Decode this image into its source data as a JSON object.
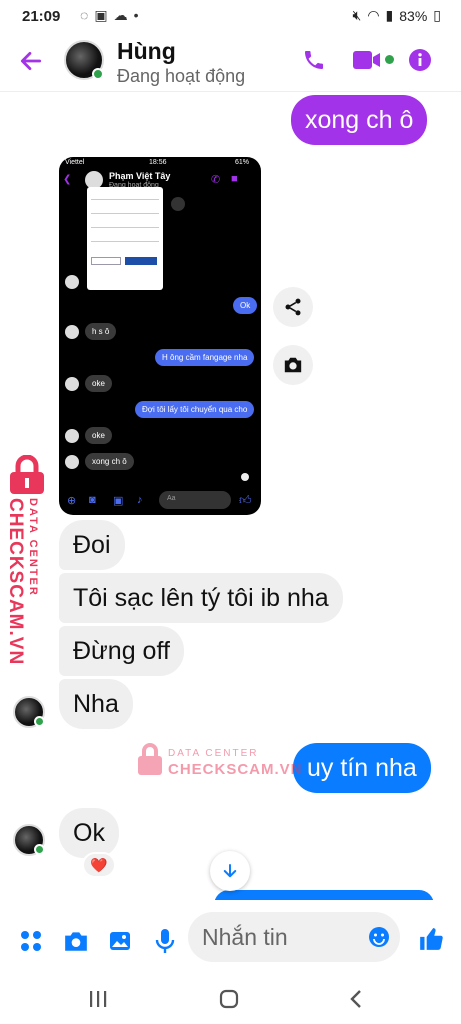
{
  "status_bar": {
    "time": "21:09",
    "battery": "83%"
  },
  "header": {
    "contact_name": "Hùng",
    "presence": "Đang hoạt động",
    "icons": [
      "back-arrow-icon",
      "phone-icon",
      "video-call-icon",
      "info-icon"
    ]
  },
  "colors": {
    "accent_purple": "#a333e8",
    "bubble_blue": "#0a7cff",
    "bubble_gray": "#efefef",
    "online_green": "#31a24c",
    "watermark_red": "#e8375a"
  },
  "messages": {
    "top_outgoing": "xong ch ô",
    "screenshot": {
      "statusbar_left": "Viettel",
      "statusbar_time": "18:56",
      "statusbar_right": "61%",
      "contact_name": "Phạm Việt Tây",
      "presence": "Đang hoạt động",
      "bubbles": {
        "b1": "Ok",
        "b2": "h s ô",
        "b3": "H ông cầm fangage nha",
        "b4": "oke",
        "b5": "Đợi tôi lấy tôi chuyển qua cho",
        "b6": "oke",
        "b7": "xong ch ô"
      },
      "input_placeholder": "Aa"
    },
    "m1": "Đoi",
    "m2": "Tôi sạc lên tý tôi ib nha",
    "m3": "Đừng off",
    "m4": "Nha",
    "m5": "uy tín nha",
    "m6": "Ok",
    "reaction": "❤️"
  },
  "watermark": {
    "side_line1": "DATA CENTER",
    "side_line2": "CHECKSCAM.VN",
    "center_line1": "DATA CENTER",
    "center_line2": "CHECKSCAM.VN"
  },
  "composer": {
    "placeholder": "Nhắn tin",
    "icons": [
      "apps-icon",
      "camera-icon",
      "gallery-icon",
      "mic-icon",
      "emoji-icon",
      "like-icon"
    ]
  },
  "nav": {
    "icons": [
      "recents-icon",
      "home-icon",
      "back-icon"
    ]
  }
}
